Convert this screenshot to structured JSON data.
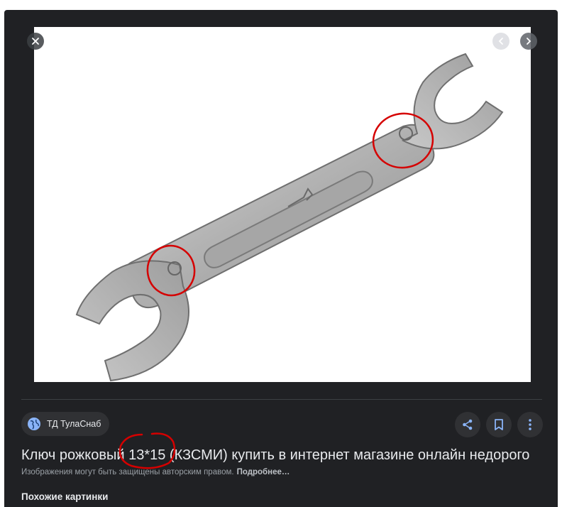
{
  "viewer": {
    "close_icon": "close-icon",
    "prev_icon": "chevron-left-icon",
    "next_icon": "chevron-right-icon",
    "image_subject": "open-end wrench"
  },
  "source": {
    "name": "ТД ТулаСнаб",
    "icon": "globe-icon"
  },
  "actions": {
    "share_icon": "share-icon",
    "save_icon": "bookmark-icon",
    "more_icon": "more-vert-icon"
  },
  "result": {
    "title": "Ключ рожковый 13*15 (КЗСМИ) купить в интернет магазине онлайн недорого",
    "copyright": "Изображения могут быть защищены авторским правом.",
    "copyright_more": "Подробнее…"
  },
  "similar": {
    "heading": "Похожие картинки"
  },
  "colors": {
    "panel": "#202124",
    "chip": "#303134",
    "text": "#e8eaed",
    "muted": "#9aa0a6",
    "annotation": "#d50000"
  }
}
